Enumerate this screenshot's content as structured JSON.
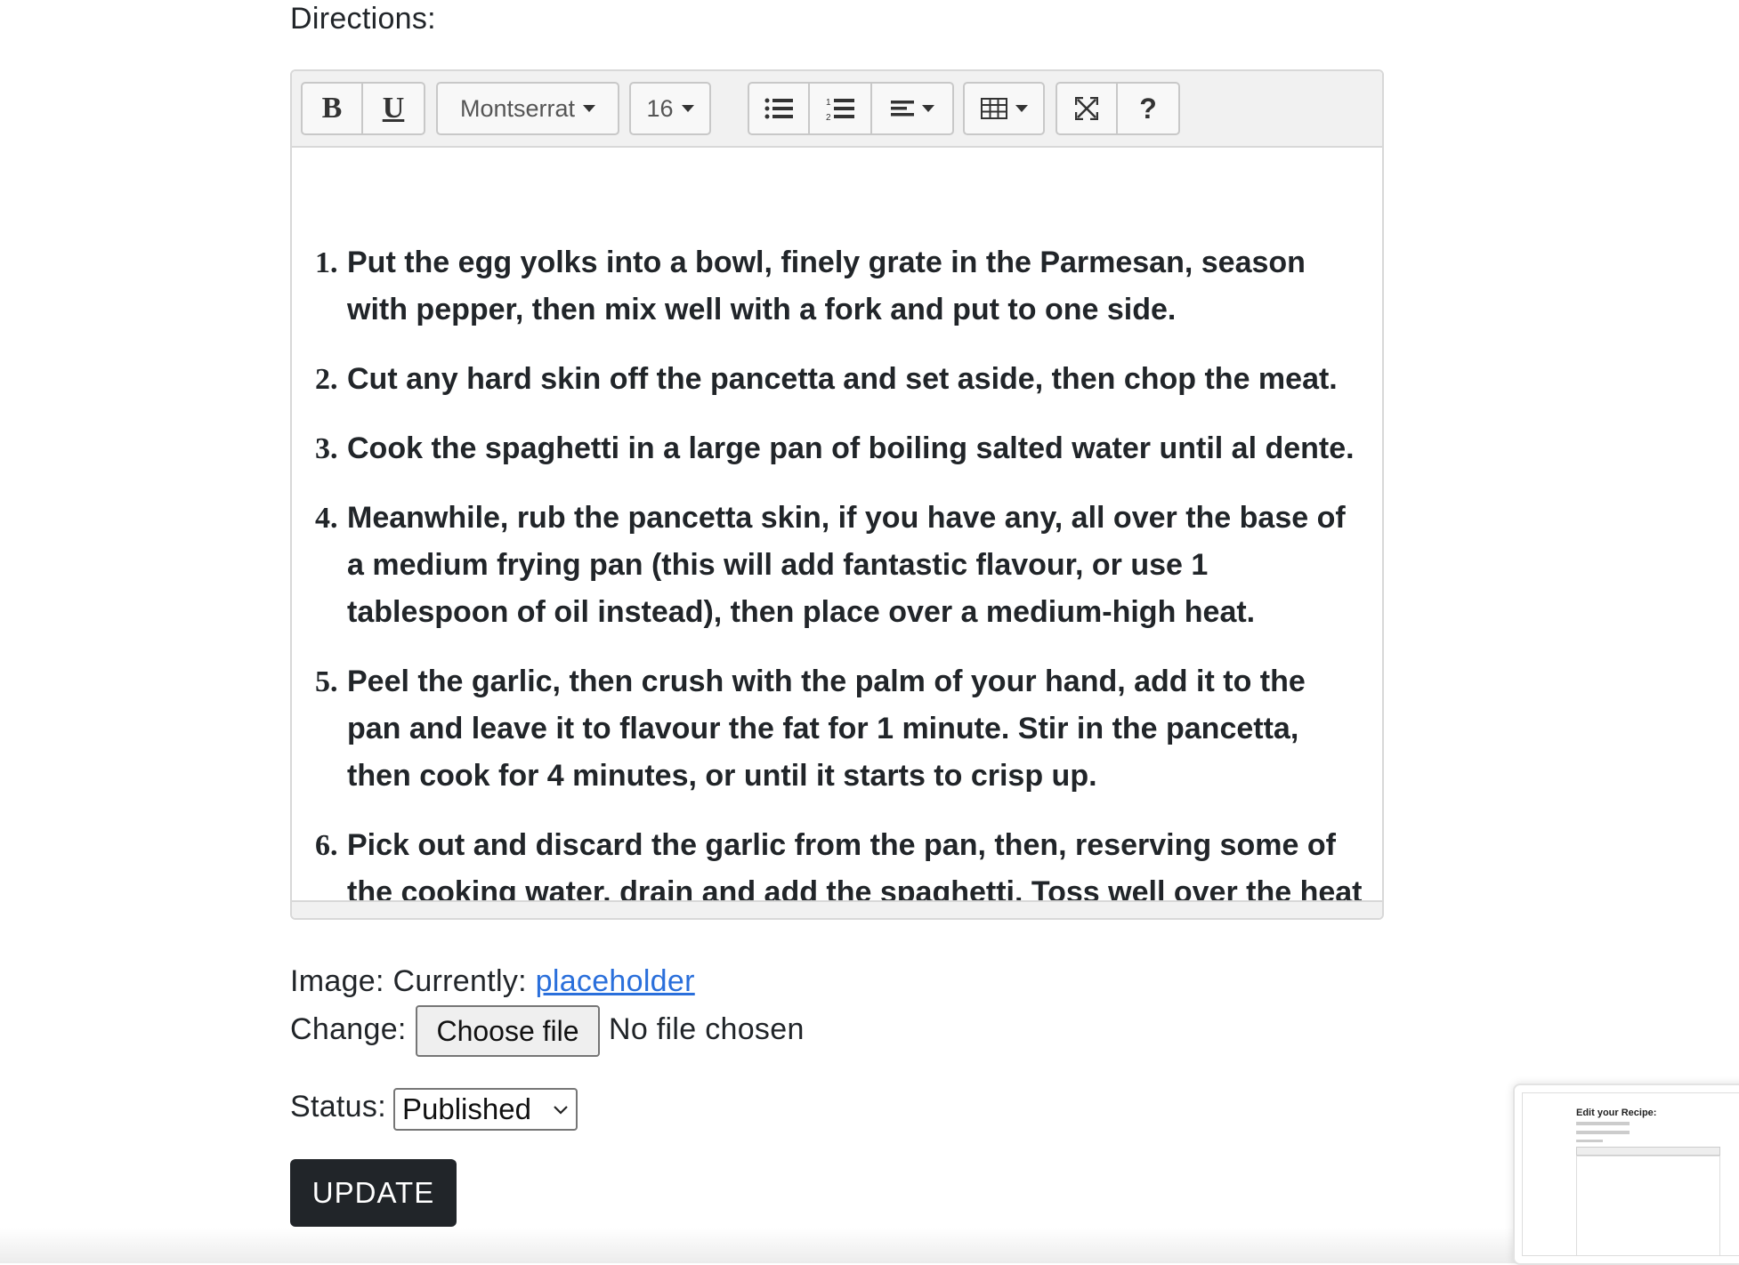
{
  "directions_label": "Directions:",
  "toolbar": {
    "bold": "B",
    "underline": "U",
    "font_name": "Montserrat",
    "font_size": "16",
    "help": "?"
  },
  "steps": [
    "Put the egg yolks into a bowl, finely grate in the Parmesan, season with pepper, then mix well with a fork and put to one side.",
    "Cut any hard skin off the pancetta and set aside, then chop the meat.",
    "Cook the spaghetti in a large pan of boiling salted water until al dente.",
    "Meanwhile, rub the pancetta skin, if you have any, all over the base of a medium frying pan (this will add fantastic flavour, or use 1 tablespoon of oil instead), then place over a medium-high heat.",
    "Peel the garlic, then crush with the palm of your hand, add it to the pan and leave it to flavour the fat for 1 minute. Stir in the pancetta, then cook for 4 minutes, or until it starts to crisp up.",
    "Pick out and discard the garlic from the pan, then, reserving some of the cooking water, drain and add the spaghetti. Toss well over the heat"
  ],
  "image": {
    "label": "Image: Currently:",
    "link": "placeholder",
    "change_label": "Change:",
    "choose_button": "Choose file",
    "no_file": "No file chosen"
  },
  "status": {
    "label": "Status:",
    "selected": "Published"
  },
  "update_button": "UPDATE",
  "thumbnail": {
    "title": "Edit your Recipe:"
  }
}
